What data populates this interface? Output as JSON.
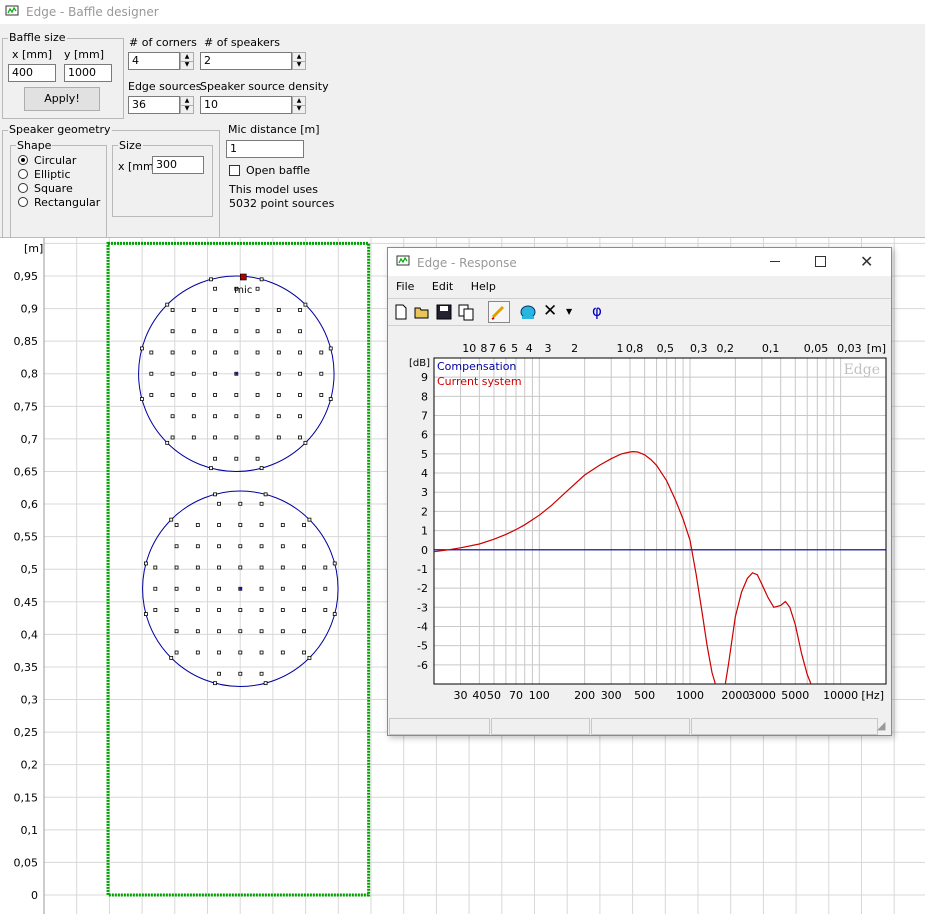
{
  "window": {
    "title": "Edge - Baffle designer"
  },
  "baffle": {
    "group_label": "Baffle size",
    "x_label": "x [mm]",
    "y_label": "y [mm]",
    "x_value": "400",
    "y_value": "1000",
    "apply_label": "Apply!"
  },
  "corners": {
    "label": "# of corners",
    "value": "4"
  },
  "speakers": {
    "label": "# of speakers",
    "value": "2"
  },
  "edge_sources": {
    "label": "Edge sources",
    "value": "36"
  },
  "density": {
    "label": "Speaker source density",
    "value": "10"
  },
  "geometry": {
    "group_label": "Speaker geometry",
    "shape_label": "Shape",
    "shapes": [
      "Circular",
      "Elliptic",
      "Square",
      "Rectangular"
    ],
    "selected": "Circular",
    "size_label": "Size",
    "size_x_label": "x [mm]",
    "size_x_value": "300"
  },
  "mic": {
    "label": "Mic distance [m]",
    "value": "1",
    "open_baffle_label": "Open baffle",
    "info_line1": "This model uses",
    "info_line2": "5032 point sources",
    "marker_label": "mic"
  },
  "canvas": {
    "unit_label": "[m]",
    "y_ticks": [
      "0,95",
      "0,9",
      "0,85",
      "0,8",
      "0,75",
      "0,7",
      "0,65",
      "0,6",
      "0,55",
      "0,5",
      "0,45",
      "0,4",
      "0,35",
      "0,3",
      "0,25",
      "0,2",
      "0,15",
      "0,1",
      "0,05",
      "0"
    ],
    "baffle_color": "#00a000",
    "speaker_color": "#0000a0"
  },
  "response": {
    "title": "Edge - Response",
    "menu": [
      "File",
      "Edit",
      "Help"
    ],
    "toolbar": [
      "new-icon",
      "open-icon",
      "save-icon",
      "copy-icon",
      "pencil-icon",
      "speaker-icon",
      "delete-icon",
      "phase-icon"
    ],
    "phase_symbol": "φ",
    "watermark": "Edge"
  },
  "chart_data": {
    "type": "line",
    "x_scale": "log",
    "xlim": [
      20,
      20000
    ],
    "ylim": [
      -7,
      10
    ],
    "ylabel": "[dB]",
    "xlabel": "[Hz]",
    "y_ticks": [
      9,
      8,
      7,
      6,
      5,
      4,
      3,
      2,
      1,
      0,
      -1,
      -2,
      -3,
      -4,
      -5,
      -6
    ],
    "x_tick_labels": [
      "30",
      "40",
      "50",
      "70",
      "100",
      "200",
      "300",
      "500",
      "1000",
      "2000",
      "3000",
      "5000",
      "10000"
    ],
    "x_ticks": [
      30,
      40,
      50,
      70,
      100,
      200,
      300,
      500,
      1000,
      2000,
      3000,
      5000,
      10000
    ],
    "top_axis_unit": "[m]",
    "top_axis_labels": [
      "10",
      "8",
      "7",
      "6",
      "5",
      "4",
      "3",
      "2",
      "1",
      "0,8",
      "0,5",
      "0,3",
      "0,2",
      "0,1",
      "0,05",
      "0,03"
    ],
    "top_axis_freqs": [
      34.3,
      42.9,
      49,
      57.2,
      68.6,
      85.8,
      114.3,
      171.5,
      343,
      428.8,
      686,
      1143,
      1715,
      3430,
      6860,
      11433
    ],
    "series": [
      {
        "name": "Compensation",
        "color": "#0000a0",
        "x": [
          20,
          20000
        ],
        "y": [
          0,
          0
        ]
      },
      {
        "name": "Current system",
        "color": "#cc0000",
        "x": [
          20,
          25,
          30,
          40,
          50,
          60,
          70,
          80,
          100,
          120,
          150,
          200,
          250,
          300,
          350,
          400,
          420,
          450,
          500,
          550,
          600,
          700,
          800,
          900,
          1000,
          1100,
          1200,
          1300,
          1400,
          1500,
          1600,
          1700,
          1800,
          2000,
          2200,
          2400,
          2600,
          2800,
          3000,
          3300,
          3600,
          4000,
          4300,
          4600,
          5000,
          5500,
          6000,
          6500
        ],
        "y": [
          -0.1,
          0,
          0.1,
          0.3,
          0.55,
          0.8,
          1.05,
          1.3,
          1.8,
          2.3,
          3.0,
          3.9,
          4.4,
          4.75,
          5.0,
          5.1,
          5.12,
          5.1,
          4.95,
          4.7,
          4.4,
          3.6,
          2.6,
          1.6,
          0.5,
          -1.3,
          -3.2,
          -5.0,
          -6.4,
          -7.2,
          -7.5,
          -7.2,
          -6.0,
          -3.5,
          -2.2,
          -1.5,
          -1.2,
          -1.3,
          -1.8,
          -2.5,
          -3.0,
          -2.9,
          -2.7,
          -3.0,
          -3.9,
          -5.4,
          -6.5,
          -7.2
        ]
      }
    ]
  }
}
